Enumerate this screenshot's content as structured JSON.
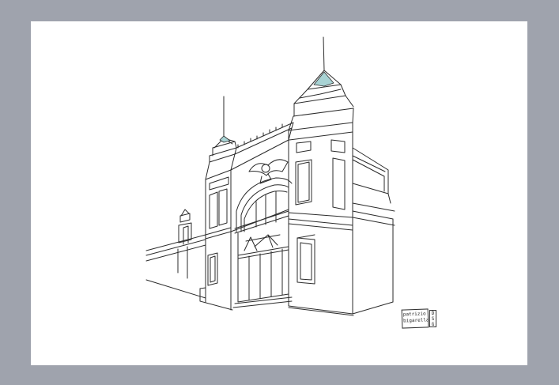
{
  "artwork": {
    "subject": "line drawing of a gate with two towers",
    "signature": {
      "line1": "patrizio",
      "line2": "bigarella",
      "stamp": [
        "D",
        "S",
        "G"
      ]
    }
  },
  "colors": {
    "mat": "#9fa3ad",
    "paper": "#ffffff",
    "ink": "#2b2b2b",
    "roof_accent": "#a8d3d4"
  }
}
